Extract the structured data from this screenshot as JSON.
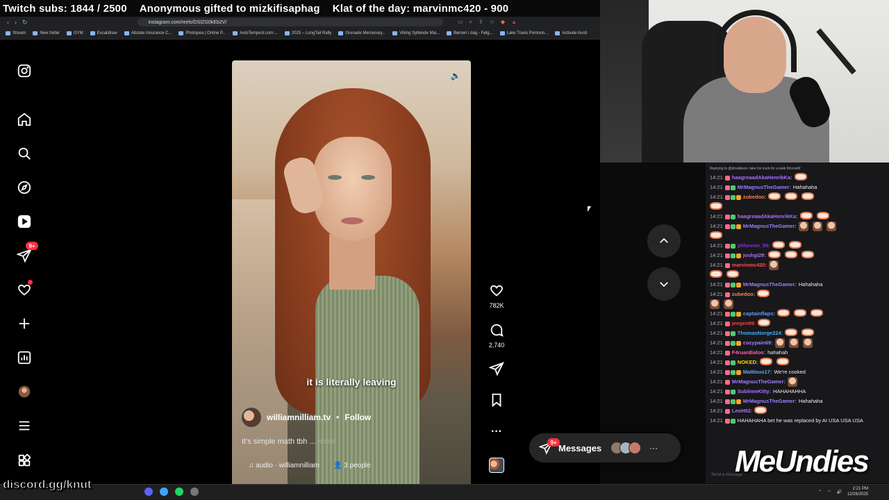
{
  "overlay": {
    "ticker_items": [
      "Twitch subs: 1844 / 2500",
      "Anonymous gifted to mizkifisaphag",
      "Klat of the day: marvinmc420 - 900"
    ]
  },
  "browser": {
    "url": "instagram.com/reels/DSIZG0kEb2V/",
    "bookmarks": [
      "Stream",
      "New folder",
      "GYM",
      "Excalidraw",
      "Allstate Insurance C...",
      "Photopea | Online P...",
      "AutoTempest.com:...",
      "2025 – LongTail Rally",
      "Grenade Mercenary...",
      "Viking Syttende Mai...",
      "Børsen i dag - Følg...",
      "Lake Travis Pontoon...",
      "Activate Austi"
    ]
  },
  "instagram": {
    "sidebar": {
      "notifications_badge": "9+",
      "icons": [
        "instagram-logo-icon",
        "home-icon",
        "search-icon",
        "explore-icon",
        "reels-icon",
        "messages-icon",
        "notifications-icon",
        "create-icon",
        "dashboard-icon",
        "profile-icon",
        "more-icon",
        "also-from-meta-icon"
      ]
    },
    "reel": {
      "caption_overlay": "it is literally leaving",
      "author": "williamnilliam.tv",
      "follow_label": "Follow",
      "description": "It's simple math tbh ...",
      "more_label": "more",
      "audio_label": "audio · williamnilliam",
      "people_label": "3 people"
    },
    "actions": {
      "likes": "782K",
      "comments": "2,740"
    },
    "messages": {
      "label": "Messages",
      "badge": "9+"
    }
  },
  "chat": {
    "reply_context": "Replying to @drnobbern: take his truck for a walk KKonaW",
    "lines": [
      {
        "ts": "14:21",
        "user": "haagreaadAkaHenrikKa:",
        "color": "#a970ff",
        "msg": ""
      },
      {
        "ts": "14:21",
        "user": "MrMagnusTheGamer:",
        "color": "#9e7dff",
        "msg": "Hahahaha"
      },
      {
        "ts": "14:21",
        "user": "zubedoo:",
        "color": "#ff7f50",
        "msg": ""
      },
      {
        "ts": "",
        "user": "",
        "color": "#fff",
        "msg": ""
      },
      {
        "ts": "14:21",
        "user": "haagreaadAkaHenrikKa:",
        "color": "#a970ff",
        "msg": ""
      },
      {
        "ts": "14:21",
        "user": "MrMagnusTheGamer:",
        "color": "#9e7dff",
        "msg": ""
      },
      {
        "ts": "",
        "user": "",
        "color": "#fff",
        "msg": ""
      },
      {
        "ts": "14:21",
        "user": "phloreon_88:",
        "color": "#8a2be2",
        "msg": ""
      },
      {
        "ts": "14:21",
        "user": "joshgi29:",
        "color": "#b36cff",
        "msg": ""
      },
      {
        "ts": "14:21",
        "user": "marvinmc420:",
        "color": "#ff4d4d",
        "msg": ""
      },
      {
        "ts": "",
        "user": "",
        "color": "#fff",
        "msg": ""
      },
      {
        "ts": "14:21",
        "user": "MrMagnusTheGamer:",
        "color": "#9e7dff",
        "msg": "Hahahaha"
      },
      {
        "ts": "14:21",
        "user": "zubedoo:",
        "color": "#ff7f50",
        "msg": ""
      },
      {
        "ts": "",
        "user": "",
        "color": "#fff",
        "msg": ""
      },
      {
        "ts": "14:21",
        "user": "captainflaps:",
        "color": "#5c9dff",
        "msg": ""
      },
      {
        "ts": "14:21",
        "user": "jeegen99:",
        "color": "#ff3b3b",
        "msg": ""
      },
      {
        "ts": "14:21",
        "user": "ThomasNorge224:",
        "color": "#38b2ff",
        "msg": ""
      },
      {
        "ts": "14:21",
        "user": "cozypain69:",
        "color": "#9e7dff",
        "msg": ""
      },
      {
        "ts": "14:21",
        "user": "F4ruanBaloo:",
        "color": "#ff5ca8",
        "msg": "hahahah"
      },
      {
        "ts": "14:21",
        "user": "NOKED:",
        "color": "#ffd200",
        "msg": ""
      },
      {
        "ts": "14:21",
        "user": "Mattious17:",
        "color": "#5fa8ff",
        "msg": "We're cooked"
      },
      {
        "ts": "14:21",
        "user": "MrMagnusTheGamer:",
        "color": "#9e7dff",
        "msg": ""
      },
      {
        "ts": "14:21",
        "user": "SublimeKitty:",
        "color": "#a970ff",
        "msg": "HAHAHAHHA"
      },
      {
        "ts": "14:21",
        "user": "MrMagnusTheGamer:",
        "color": "#9e7dff",
        "msg": "Hahahaha"
      },
      {
        "ts": "14:21",
        "user": "LeoH92:",
        "color": "#a970ff",
        "msg": ""
      },
      {
        "ts": "14:21",
        "user": "",
        "color": "#fff",
        "msg": "HAHAHAHA bet he was replaced by AI USA USA USA"
      }
    ],
    "logo": "MeUndies"
  },
  "taskbar": {
    "discord": "discord.gg/knut",
    "time": "2:21 PM",
    "date": "12/26/2025"
  }
}
